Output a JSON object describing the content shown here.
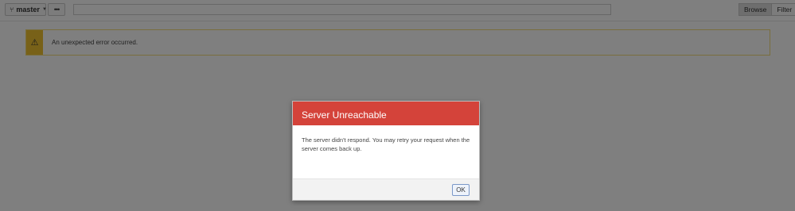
{
  "toolbar": {
    "branch_icon": "branch-icon",
    "branch_label": "master",
    "more_label": "•••",
    "path_value": "",
    "browse_label": "Browse",
    "filter_label": "Filter"
  },
  "alert": {
    "icon": "⚠",
    "message": "An unexpected error occurred."
  },
  "modal": {
    "title": "Server Unreachable",
    "body": "The server didn't respond. You may retry your request when the server comes back up.",
    "ok_label": "OK"
  },
  "colors": {
    "modal_header": "#d4433a",
    "alert_icon_bg": "#f0c230",
    "alert_border": "#f2dc7a"
  }
}
